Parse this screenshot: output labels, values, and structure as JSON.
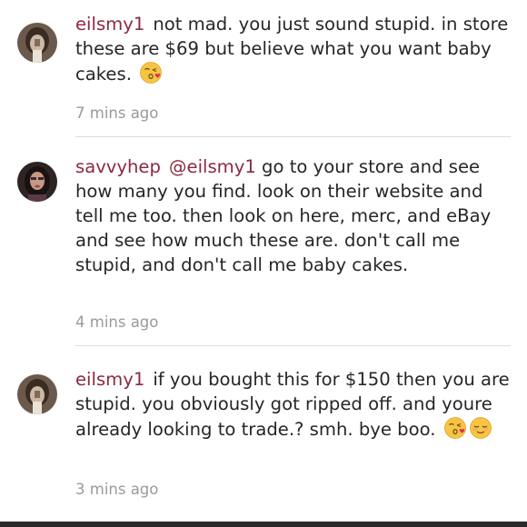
{
  "comments": [
    {
      "username": "eilsmy1",
      "mention": "",
      "text": "not mad. you just sound stupid. in store these are $69 but believe what you want baby cakes.",
      "emojis": [
        "kissing-heart-emoji"
      ],
      "time": "7 mins ago"
    },
    {
      "username": "savvyhep",
      "mention": "@eilsmy1",
      "text": " go to your store and see how many you find. look on their website and tell me too. then look on here, merc, and eBay and see how much these are. don't call me stupid, and don't call me baby cakes.",
      "emojis": [],
      "time": "4 mins ago"
    },
    {
      "username": "eilsmy1",
      "mention": "",
      "text": "if you bought this for $150 then you are stupid. you obviously got ripped off. and youre already looking to trade.? smh. bye boo.",
      "emojis": [
        "kissing-heart-emoji",
        "relieved-face-emoji"
      ],
      "time": "3 mins ago"
    }
  ],
  "colors": {
    "username": "#8b2a3e",
    "body_text": "#262626",
    "timestamp": "#9a9a9a",
    "divider": "#dcdcdc"
  }
}
